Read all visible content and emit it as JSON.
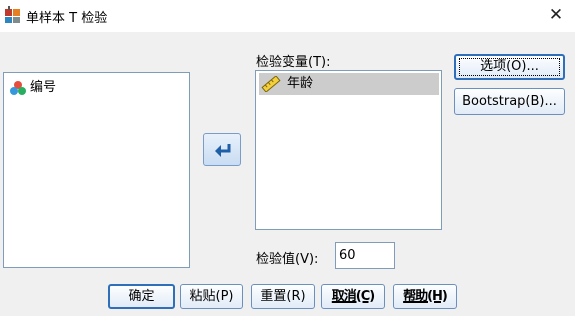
{
  "window": {
    "title": "单样本 T 检验",
    "close_glyph": "✕"
  },
  "source_list": {
    "items": [
      {
        "label": "编号",
        "icon": "nominal-variable-icon"
      }
    ]
  },
  "move_button": {
    "icon": "move-right-arrow-icon"
  },
  "test_variables": {
    "label": "检验变量(T):",
    "items": [
      {
        "label": "年龄",
        "icon": "scale-variable-ruler-icon"
      }
    ]
  },
  "test_value": {
    "label": "检验值(V):",
    "value": "60"
  },
  "side_buttons": {
    "options": "选项(O)...",
    "bootstrap": "Bootstrap(B)..."
  },
  "bottom_buttons": {
    "ok": "确定",
    "paste": "粘贴(P)",
    "reset": "重置(R)",
    "cancel": "取消(C)",
    "help": "帮助(H)"
  },
  "colors": {
    "selection": "#cccccc",
    "list_border": "#7f9db9",
    "button_border": "#6b8fbf",
    "dialog_bg": "#f0f0f0"
  }
}
